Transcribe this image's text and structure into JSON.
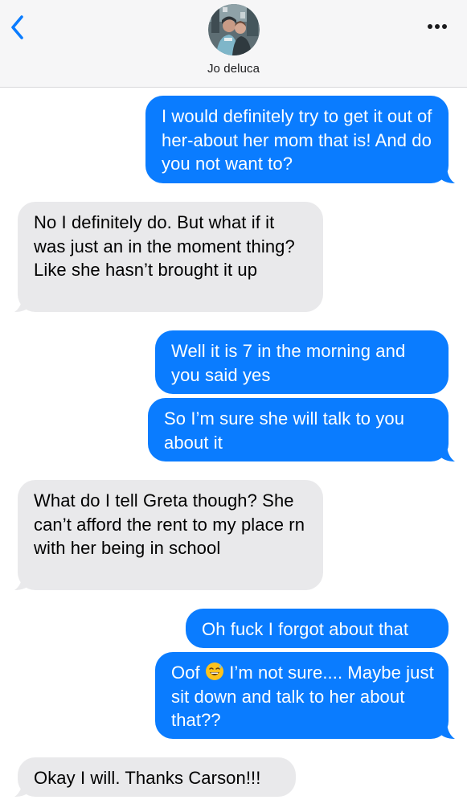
{
  "header": {
    "contact_name": "Jo deluca",
    "back_icon": "chevron-left-icon",
    "more_icon": "ellipsis-icon"
  },
  "colors": {
    "sent_bubble": "#0a7cff",
    "received_bubble": "#e9e9eb",
    "accent": "#0a7cff"
  },
  "messages": [
    {
      "side": "sent",
      "text": "I would definitely try to get it out of her-about her mom that is! And do you not want to?"
    },
    {
      "side": "received",
      "text": "No I definitely do. But what if it was just an in the moment thing? Like she hasn’t brought it up"
    },
    {
      "side": "sent",
      "text": "Well it is 7 in the morning and you said yes"
    },
    {
      "side": "sent",
      "text": "So I’m sure she will talk to you about it"
    },
    {
      "side": "received",
      "text": "What do I tell Greta though? She can’t afford the rent to my place rn with her being in school"
    },
    {
      "side": "sent",
      "text": "Oh fuck I forgot about that"
    },
    {
      "side": "sent",
      "text_before_emoji": "Oof",
      "emoji": "grinning-sweat-emoji",
      "text_after_emoji": "I’m not sure.... Maybe just sit down and talk to her about that??"
    },
    {
      "side": "received",
      "text": "Okay I will. Thanks Carson!!!"
    }
  ]
}
